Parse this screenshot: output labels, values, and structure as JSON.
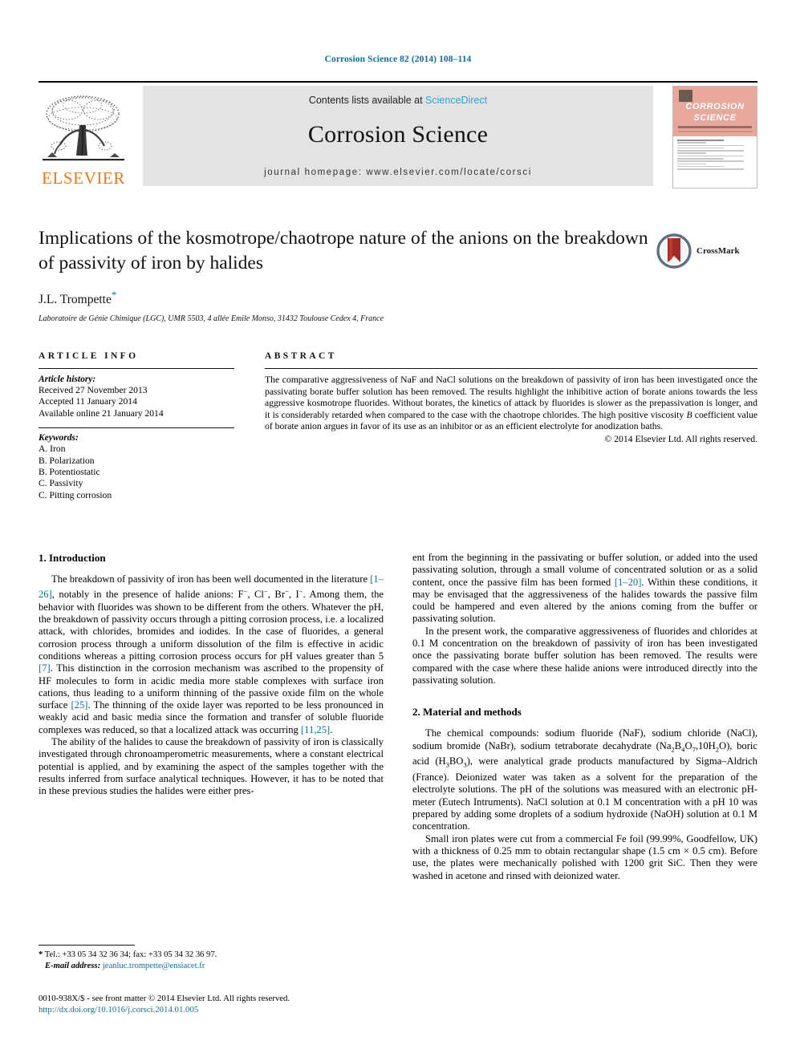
{
  "running_head": "Corrosion Science 82 (2014) 108–114",
  "masthead": {
    "publisher_wordmark": "ELSEVIER",
    "contents_prefix": "Contents lists available at ",
    "contents_link": "ScienceDirect",
    "journal_title": "Corrosion Science",
    "homepage": "journal homepage: www.elsevier.com/locate/corsci",
    "cover": {
      "line1": "CORROSION",
      "line2": "SCIENCE"
    },
    "colors": {
      "elsevier_orange": "#e8771f",
      "sciencedirect_blue": "#2aa3d4",
      "banner_grey": "#e3e3e3",
      "cover_salmon": "#e7a79c",
      "link_teal": "#0f6e96"
    }
  },
  "title_block": {
    "title": "Implications of the kosmotrope/chaotrope nature of the anions on the breakdown of passivity of iron by halides",
    "author": "J.L. Trompette",
    "author_footnote_mark": "*",
    "affiliation": "Laboratoire de Génie Chimique (LGC), UMR 5503, 4 allée Emile Monso, 31432 Toulouse Cedex 4, France",
    "crossmark_label": "CrossMark"
  },
  "article_info": {
    "heading": "ARTICLE INFO",
    "history_title": "Article history:",
    "history": [
      "Received 27 November 2013",
      "Accepted 11 January 2014",
      "Available online 21 January 2014"
    ],
    "keywords_title": "Keywords:",
    "keywords": [
      "A. Iron",
      "B. Polarization",
      "B. Potentiostatic",
      "C. Passivity",
      "C. Pitting corrosion"
    ]
  },
  "abstract": {
    "heading": "ABSTRACT",
    "text_part1": "The comparative aggressiveness of NaF and NaCl solutions on the breakdown of passivity of iron has been investigated once the passivating borate buffer solution has been removed. The results highlight the inhibitive action of borate anions towards the less aggressive kosmotrope fluorides. Without borates, the kinetics of attack by fluorides is slower as the prepassivation is longer, and it is considerably retarded when compared to the case with the chaotrope chlorides. The high positive viscosity ",
    "text_italic": "B",
    "text_part2": " coefficient value of borate anion argues in favor of its use as an inhibitor or as an efficient electrolyte for anodization baths.",
    "copyright": "© 2014 Elsevier Ltd. All rights reserved."
  },
  "sections": {
    "introduction_heading": "1. Introduction",
    "methods_heading": "2. Material and methods"
  },
  "body": {
    "intro_p1_a": "The breakdown of passivity of iron has been well documented in the literature ",
    "intro_p1_ref1": "[1–26]",
    "intro_p1_b": ", notably in the presence of halide anions: F",
    "intro_p1_c": ", Cl",
    "intro_p1_d": ", Br",
    "intro_p1_e": ", I",
    "intro_p1_f": ". Among them, the behavior with fluorides was shown to be different from the others. Whatever the pH, the breakdown of passivity occurs through a pitting corrosion process, i.e. a localized attack, with chlorides, bromides and iodides. In the case of fluorides, a general corrosion process through a uniform dissolution of the film is effective in acidic conditions whereas a pitting corrosion process occurs for pH values greater than 5 ",
    "intro_p1_ref2": "[7]",
    "intro_p1_g": ". This distinction in the corrosion mechanism was ascribed to the propensity of HF molecules to form in acidic media more stable complexes with surface iron cations, thus leading to a uniform thinning of the passive oxide film on the whole surface ",
    "intro_p1_ref3": "[25]",
    "intro_p1_h": ". The thinning of the oxide layer was reported to be less pronounced in weakly acid and basic media since the formation and transfer of soluble fluoride complexes was reduced, so that a localized attack was occurring ",
    "intro_p1_ref4": "[11,25]",
    "intro_p1_i": ".",
    "intro_p2": "The ability of the halides to cause the breakdown of passivity of iron is classically investigated through chronoamperometric measurements, where a constant electrical potential is applied, and by examining the aspect of the samples together with the results inferred from surface analytical techniques. However, it has to be noted that in these previous studies the halides were either pres-",
    "intro_p3_a": "ent from the beginning in the passivating or buffer solution, or added into the used passivating solution, through a small volume of concentrated solution or as a solid content, once the passive film has been formed ",
    "intro_p3_ref": "[1–20]",
    "intro_p3_b": ". Within these conditions, it may be envisaged that the aggressiveness of the halides towards the passive film could be hampered and even altered by the anions coming from the buffer or passivating solution.",
    "intro_p4": "In the present work, the comparative aggressiveness of fluorides and chlorides at 0.1 M concentration on the breakdown of passivity of iron has been investigated once the passivating borate buffer solution has been removed. The results were compared with the case where these halide anions were introduced directly into the passivating solution.",
    "methods_p1_a": "The chemical compounds: sodium fluoride (NaF), sodium chloride (NaCl), sodium bromide (NaBr), sodium tetraborate decahydrate (Na",
    "methods_p1_sub1": "2",
    "methods_p1_b": "B",
    "methods_p1_sub2": "4",
    "methods_p1_c": "O",
    "methods_p1_sub3": "7",
    "methods_p1_d": ",10H",
    "methods_p1_sub4": "2",
    "methods_p1_e": "O), boric acid (H",
    "methods_p1_sub5": "3",
    "methods_p1_f": "BO",
    "methods_p1_sub6": "3",
    "methods_p1_g": "), were analytical grade products manufactured by Sigma–Aldrich (France). Deionized water was taken as a solvent for the preparation of the electrolyte solutions. The pH of the solutions was measured with an electronic pH-meter (Eutech Intruments). NaCl solution at 0.1 M concentration with a pH 10 was prepared by adding some droplets of a sodium hydroxide (NaOH) solution at 0.1 M concentration.",
    "methods_p2": "Small iron plates were cut from a commercial Fe foil (99.99%, Goodfellow, UK) with a thickness of 0.25 mm to obtain rectangular shape (1.5 cm × 0.5 cm). Before use, the plates were mechanically polished with 1200 grit SiC. Then they were washed in acetone and rinsed with deionized water."
  },
  "footnote": {
    "mark": "*",
    "contact": "Tel.: +33 05 34 32 36 34; fax: +33 05 34 32 36 97.",
    "email_label": "E-mail address:",
    "email": "jeanluc.trompette@ensiacet.fr"
  },
  "footer": {
    "issn_line": "0010-938X/$ - see front matter © 2014 Elsevier Ltd. All rights reserved.",
    "doi": "http://dx.doi.org/10.1016/j.corsci.2014.01.005"
  }
}
